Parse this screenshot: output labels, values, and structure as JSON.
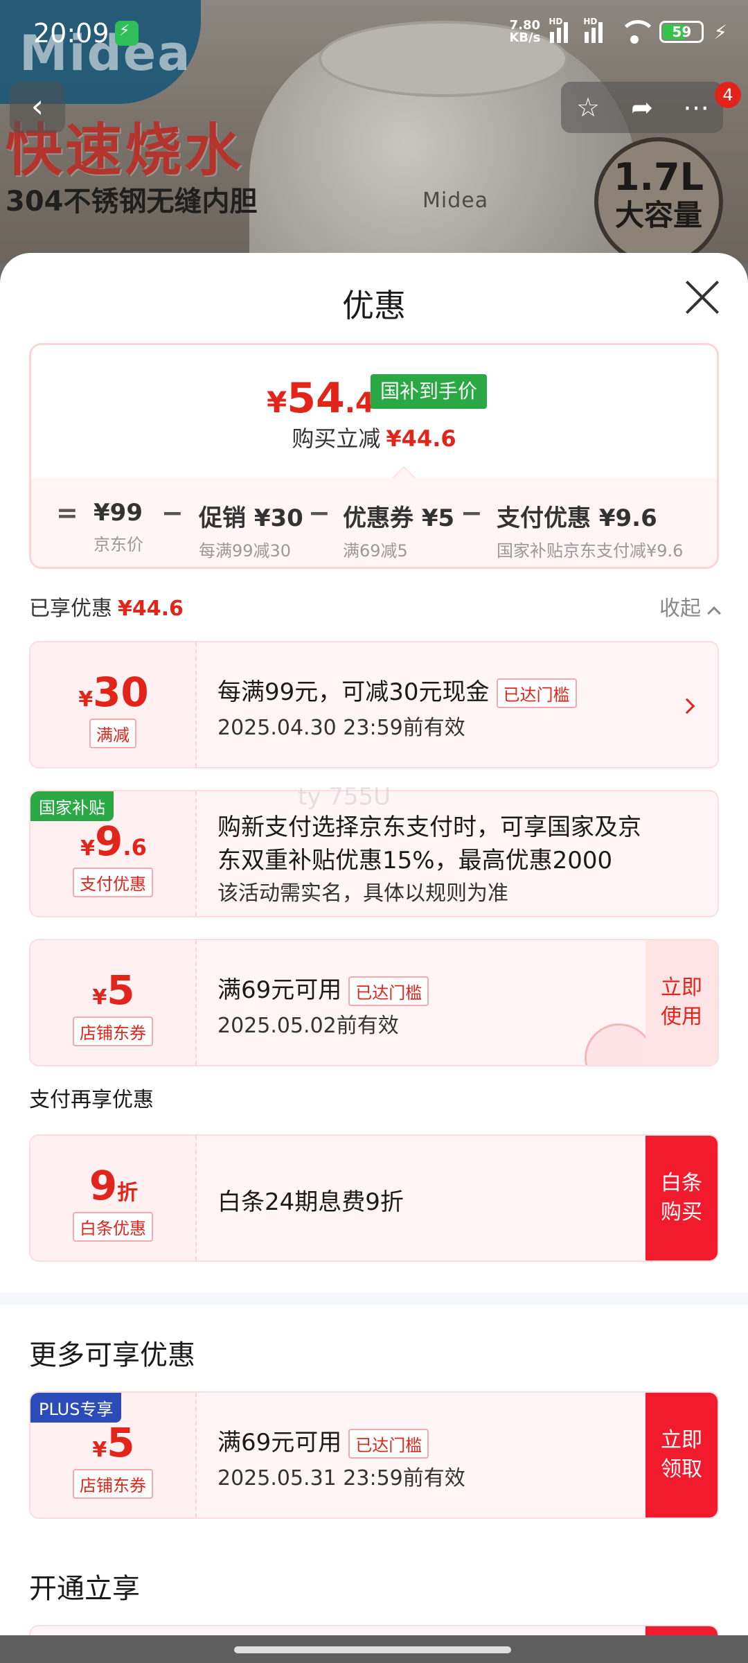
{
  "status_bar": {
    "time": "20:09",
    "net_speed_top": "7.80",
    "net_speed_bottom": "KB/s",
    "battery": "59",
    "hd1": "HD",
    "hd2": "HD"
  },
  "hero": {
    "brand": "Midea",
    "promo1": "快速烧水",
    "promo2": "304不锈钢无缝内胆",
    "kettle_logo": "Midea",
    "capacity1": "1.7L",
    "capacity2": "大容量",
    "message_count": "4"
  },
  "sheet": {
    "title": "优惠",
    "price": {
      "currency": "¥",
      "integer": "54",
      "decimal": ".4",
      "tag": "国补到手价",
      "buy_label": "购买立减",
      "buy_amount": "¥44.6"
    },
    "calc": {
      "equals": "=",
      "minus": "−",
      "items": [
        {
          "value": "¥99",
          "sub": "京东价"
        },
        {
          "value": "促销 ¥30",
          "sub": "每满99减30"
        },
        {
          "value": "优惠券 ¥5",
          "sub": "满69减5"
        },
        {
          "value": "支付优惠 ¥9.6",
          "sub": "国家补贴京东支付减¥9.6"
        }
      ]
    },
    "enjoyed": {
      "label": "已享优惠",
      "amount": "¥44.6",
      "collapse": "收起"
    },
    "coupons": [
      {
        "currency": "¥",
        "num": "30",
        "small": "",
        "tag": "满减",
        "line1": "每满99元，可减30元现金",
        "threshold": "已达门槛",
        "line2": "2025.04.30 23:59前有效"
      },
      {
        "corner": "国家补贴",
        "currency": "¥",
        "num": "9",
        "small": ".6",
        "tag": "支付优惠",
        "line1": "购新支付选择京东支付时，可享国家及京",
        "line1b": "东双重补贴优惠15%，最高优惠2000",
        "line2": "该活动需实名，具体以规则为准"
      },
      {
        "currency": "¥",
        "num": "5",
        "small": "",
        "tag": "店铺东券",
        "line1": "满69元可用",
        "threshold": "已达门槛",
        "line2": "2025.05.02前有效",
        "button": "立即使用",
        "button1": "立即",
        "button2": "使用"
      }
    ],
    "pay_section": "支付再享优惠",
    "baitiao": {
      "num": "9",
      "unit": "折",
      "tag": "白条优惠",
      "line1": "白条24期息费9折",
      "button1": "白条",
      "button2": "购买"
    },
    "more_section": "更多可享优惠",
    "plus_coupon": {
      "corner": "PLUS专享",
      "currency": "¥",
      "num": "5",
      "tag": "店铺东券",
      "line1": "满69元可用",
      "threshold": "已达门槛",
      "line2": "2025.05.31 23:59前有效",
      "button1": "立即",
      "button2": "领取"
    },
    "open_section": "开通立享",
    "watermark": "ty 755U"
  },
  "colors": {
    "accent": "#e1251b",
    "green_tag": "#2aa844",
    "plus_blue": "#2a4bb8",
    "button_red": "#f21b2e"
  }
}
